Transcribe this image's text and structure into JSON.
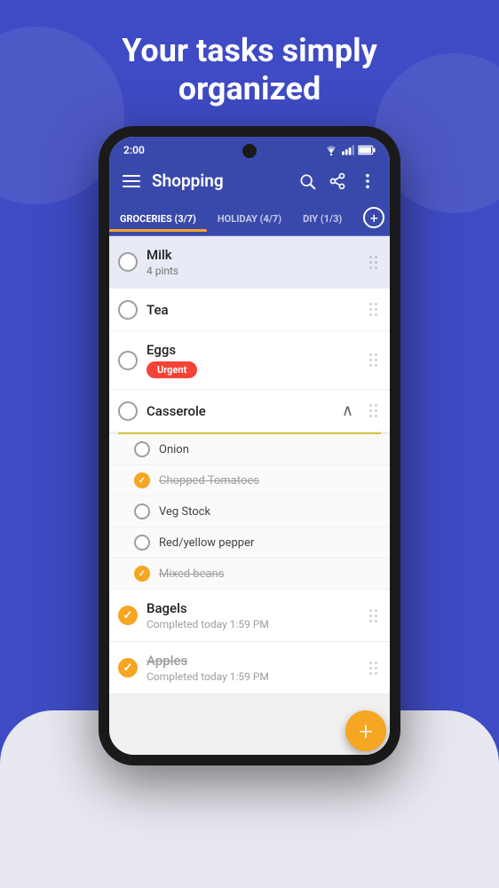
{
  "header": {
    "line1": "Your tasks simply",
    "line2": "organized"
  },
  "status_bar": {
    "time": "2:00",
    "icons": [
      "wifi",
      "signal",
      "battery"
    ]
  },
  "app_bar": {
    "title": "Shopping",
    "icons": [
      "menu",
      "search",
      "share",
      "more"
    ]
  },
  "tabs": [
    {
      "label": "GROCERIES (3/7)",
      "active": true
    },
    {
      "label": "HOLIDAY (4/7)",
      "active": false
    },
    {
      "label": "DIY (1/3)",
      "active": false
    }
  ],
  "list_items": [
    {
      "id": "milk",
      "title": "Milk",
      "subtitle": "4 pints",
      "checked": false,
      "highlighted": true,
      "urgent": false,
      "completed": false
    },
    {
      "id": "tea",
      "title": "Tea",
      "subtitle": "",
      "checked": false,
      "highlighted": false,
      "urgent": false,
      "completed": false
    },
    {
      "id": "eggs",
      "title": "Eggs",
      "subtitle": "",
      "checked": false,
      "highlighted": false,
      "urgent": true,
      "urgent_label": "Urgent",
      "completed": false
    },
    {
      "id": "casserole",
      "title": "Casserole",
      "checked": false,
      "highlighted": false,
      "expanded": true,
      "sub_items": [
        {
          "label": "Onion",
          "checked": false,
          "strikethrough": false
        },
        {
          "label": "Chopped Tomatoes",
          "checked": true,
          "strikethrough": true
        },
        {
          "label": "Veg Stock",
          "checked": false,
          "strikethrough": false
        },
        {
          "label": "Red/yellow pepper",
          "checked": false,
          "strikethrough": false
        },
        {
          "label": "Mixed beans",
          "checked": true,
          "strikethrough": true
        }
      ]
    },
    {
      "id": "bagels",
      "title": "Bagels",
      "subtitle": "Completed today 1:59 PM",
      "checked": true,
      "highlighted": false,
      "urgent": false,
      "completed": true
    },
    {
      "id": "apples",
      "title": "Apples",
      "subtitle": "Completed today 1:59 PM",
      "checked": true,
      "highlighted": false,
      "urgent": false,
      "completed": true,
      "strikethrough": true
    }
  ],
  "fab": {
    "label": "+"
  }
}
